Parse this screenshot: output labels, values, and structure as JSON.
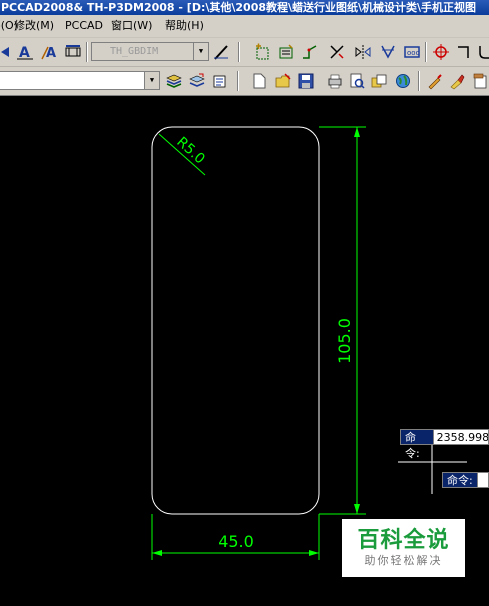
{
  "window": {
    "title": "PCCAD2008& TH-P3DM2008 - [D:\\其他\\2008教程\\蜡送行业图纸\\机械设计类\\手机正视图"
  },
  "menu": {
    "items": [
      "o(O)",
      "修改(M)",
      "PCCAD",
      "窗口(W)",
      "帮助(H)"
    ]
  },
  "toolbar": {
    "dim_style_combo": "TH_GBDIM",
    "layer_combo": ""
  },
  "drawing": {
    "radius_label": "R5.0",
    "height_label": "105.0",
    "width_label": "45.0",
    "line_color": "#ffffff",
    "dim_color": "#00ff00",
    "background": "#000000"
  },
  "command": {
    "prompt_label": "命令:",
    "prompt_value": "2358.998",
    "prompt2_label": "命令:",
    "prompt2_value": ""
  },
  "watermark": {
    "brand": "百科全说",
    "tagline": "助你轻松解决"
  }
}
